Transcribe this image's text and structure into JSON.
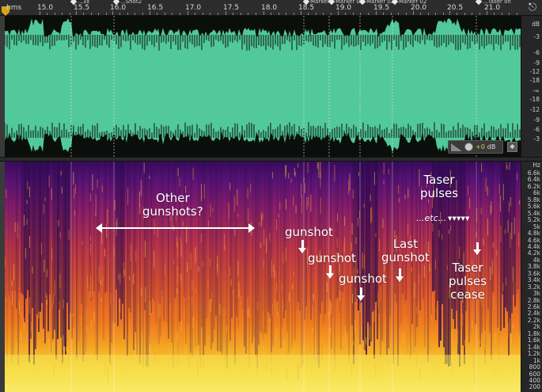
{
  "ruler": {
    "unit": "hms",
    "ticks": [
      "15.0",
      "15.5",
      "16.0",
      "16.5",
      "17.0",
      "17.5",
      "18.0",
      "18.5",
      "19.0",
      "19.5",
      "20.0",
      "20.5",
      "21.0"
    ],
    "markers": [
      "...3x",
      "...Shot2",
      "Marker...",
      "Marker 01",
      "Marker 02",
      "Marker 02",
      "...Taser on"
    ]
  },
  "waveform": {
    "color": "#52c99a",
    "db_scale": [
      "dB",
      "-3",
      "-6",
      "-9",
      "-12",
      "-18",
      "-∞",
      "-18",
      "-12",
      "-9",
      "-6",
      "-3"
    ]
  },
  "hud": {
    "volume_value": "+0",
    "volume_unit": "dB"
  },
  "spectrogram": {
    "hz_scale": [
      "Hz",
      "6.6k",
      "6.4k",
      "6.2k",
      "6k",
      "5.8k",
      "5.6k",
      "5.4k",
      "5.2k",
      "5k",
      "4.8k",
      "4.6k",
      "4.4k",
      "4.2k",
      "4k",
      "3.8k",
      "3.6k",
      "3.4k",
      "3.2k",
      "3k",
      "2.8k",
      "2.6k",
      "2.4k",
      "2.2k",
      "2k",
      "1.8k",
      "1.6k",
      "1.4k",
      "1.2k",
      "1k",
      "800",
      "600",
      "400",
      "200"
    ]
  },
  "annotations": {
    "other_gunshots_line1": "Other",
    "other_gunshots_line2": "gunshots?",
    "gunshot_1": "gunshot",
    "gunshot_2": "gunshot",
    "gunshot_3": "gunshot",
    "last_gunshot_line1": "Last",
    "last_gunshot_line2": "gunshot",
    "taser_pulses_line1": "Taser",
    "taser_pulses_line2": "pulses",
    "etc": "...etc...",
    "taser_cease_line1": "Taser",
    "taser_cease_line2": "pulses",
    "taser_cease_line3": "cease"
  }
}
